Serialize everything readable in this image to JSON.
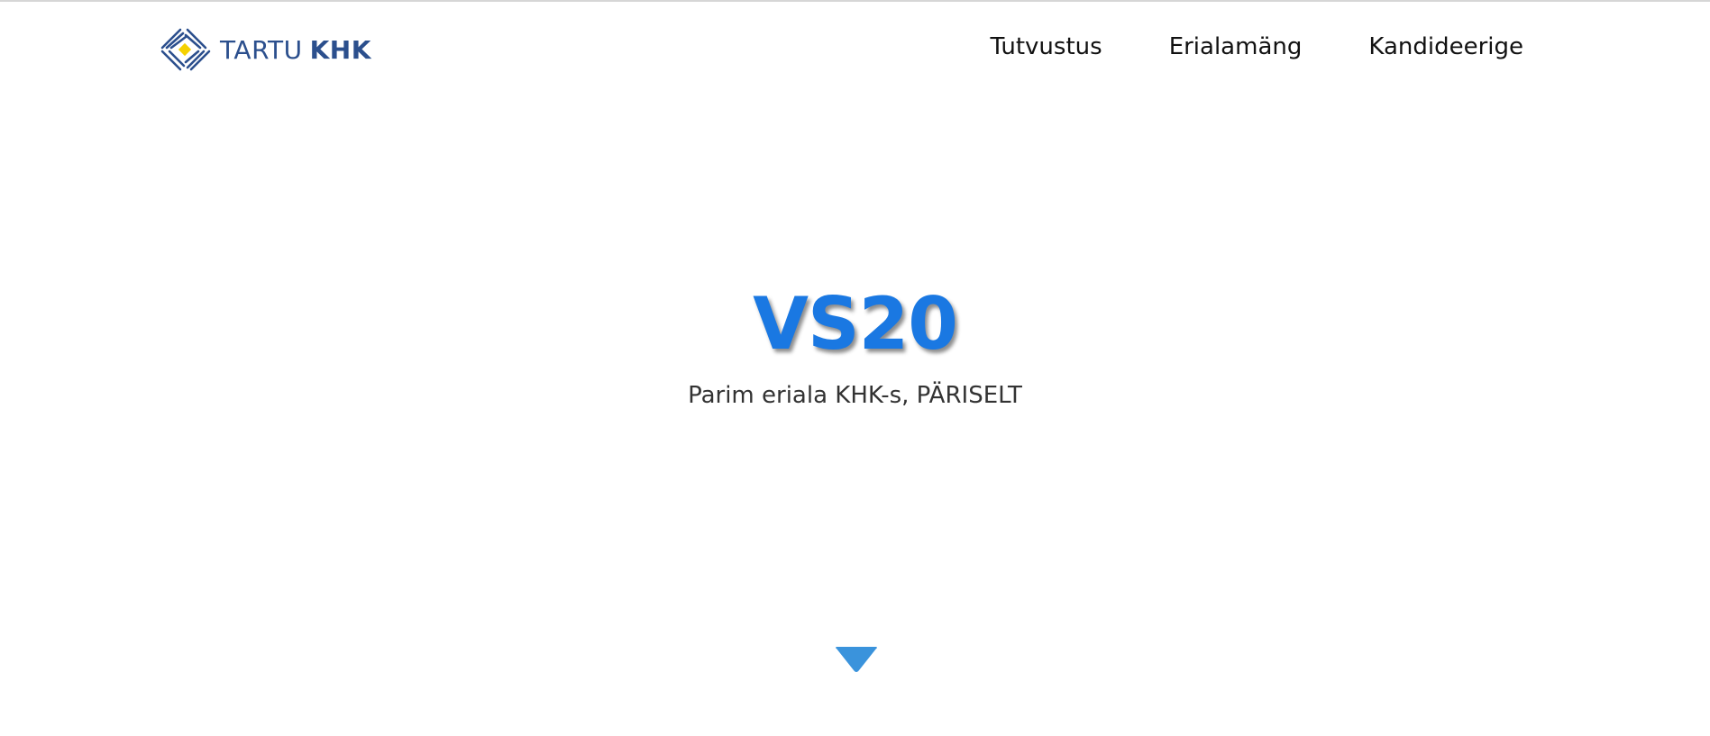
{
  "brand": {
    "name_plain": "TARTU",
    "name_strong": "KHK",
    "color": "#2b4f8d",
    "accent_color": "#f5d100"
  },
  "nav": {
    "items": [
      {
        "label": "Tutvustus"
      },
      {
        "label": "Erialamäng"
      },
      {
        "label": "Kandideerige"
      }
    ]
  },
  "hero": {
    "title": "VS20",
    "subtitle": "Parim eriala KHK-s, PÄRISELT",
    "title_color": "#1a78e2"
  },
  "scroll": {
    "icon": "triangle-down-icon",
    "color": "#3a93dc"
  }
}
